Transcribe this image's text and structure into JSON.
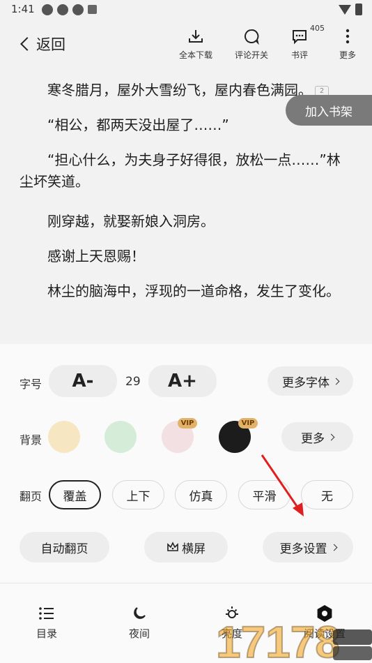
{
  "status_bar": {
    "time": "1:41"
  },
  "header": {
    "back_label": "返回",
    "actions": [
      {
        "label": "全本下载",
        "icon": "download-icon"
      },
      {
        "label": "评论开关",
        "icon": "comment-toggle-icon"
      },
      {
        "label": "书评",
        "icon": "review-icon",
        "count": "405"
      },
      {
        "label": "更多",
        "icon": "more-vertical-icon"
      }
    ]
  },
  "reader": {
    "paragraphs": [
      "寒冬腊月，屋外大雪纷飞，屋内春色满园。",
      "“相公，都两天没出屋了……”",
      "“担心什么，为夫身子好得很，放松一点……”林尘坏笑道。",
      "刚穿越，就娶新娘入洞房。",
      "感谢上天恩赐！",
      "林尘的脑海中，浮现的一道命格，发生了变化。"
    ],
    "page_note": "2",
    "add_shelf_label": "加入书架"
  },
  "settings": {
    "font_label": "字号",
    "font_decrease": "A-",
    "font_size": "29",
    "font_increase": "A+",
    "more_fonts": "更多字体",
    "bg_label": "背景",
    "bg_colors": [
      "#f7e6c2",
      "#d5ecd9",
      "#f2e0e2",
      "#1c1c1c"
    ],
    "vip_label": "VIP",
    "bg_more": "更多",
    "turn_label": "翻页",
    "turn_modes": [
      "覆盖",
      "上下",
      "仿真",
      "平滑",
      "无"
    ],
    "turn_selected": "覆盖",
    "auto_turn": "自动翻页",
    "landscape": "横屏",
    "more_settings": "更多设置"
  },
  "bottom_nav": [
    {
      "label": "目录",
      "icon": "list-icon"
    },
    {
      "label": "夜间",
      "icon": "moon-icon"
    },
    {
      "label": "亮度",
      "icon": "brightness-icon"
    },
    {
      "label": "阅读设置",
      "icon": "settings-hex-icon"
    }
  ],
  "colors": {
    "accent_arrow": "#e02020",
    "panel_bg": "#fafafa",
    "reader_bg": "#f2f2f2"
  }
}
